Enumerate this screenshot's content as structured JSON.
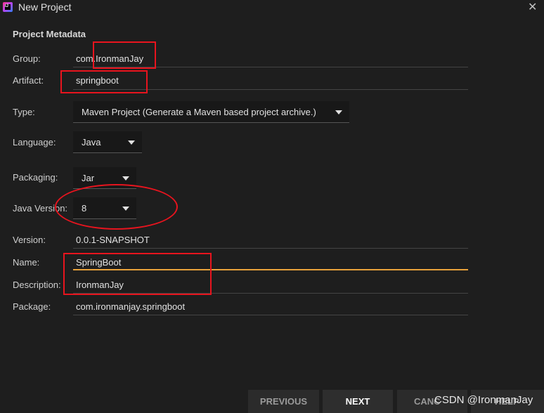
{
  "window": {
    "title": "New Project",
    "close_glyph": "✕"
  },
  "section": {
    "title": "Project Metadata"
  },
  "fields": {
    "group": {
      "label": "Group:",
      "value": "com.IronmanJay"
    },
    "artifact": {
      "label": "Artifact:",
      "value": "springboot"
    },
    "type": {
      "label": "Type:",
      "value": "Maven Project (Generate a Maven based project archive.)"
    },
    "language": {
      "label": "Language:",
      "value": "Java"
    },
    "packaging": {
      "label": "Packaging:",
      "value": "Jar"
    },
    "java_version": {
      "label": "Java Version:",
      "value": "8"
    },
    "version": {
      "label": "Version:",
      "value": "0.0.1-SNAPSHOT"
    },
    "name": {
      "label": "Name:",
      "value": "SpringBoot"
    },
    "description": {
      "label": "Description:",
      "value": "IronmanJay"
    },
    "package": {
      "label": "Package:",
      "value": "com.ironmanjay.springboot"
    }
  },
  "buttons": {
    "previous": "PREVIOUS",
    "next": "NEXT",
    "cancel": "CANC",
    "help": "HELP"
  },
  "watermark": "CSDN @IronmanJay",
  "colors": {
    "background": "#1e1e1e",
    "focus_underline": "#e8a23b",
    "annotation_red": "#e8141e"
  }
}
